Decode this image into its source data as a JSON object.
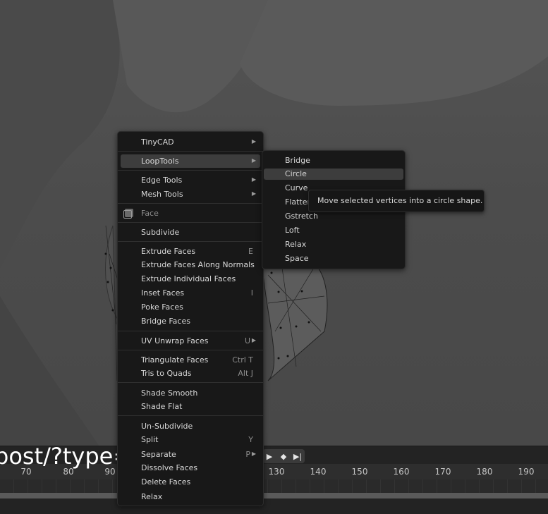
{
  "main_menu": {
    "items": [
      {
        "label": "TinyCAD",
        "submenu": true
      },
      {
        "label": "LoopTools",
        "submenu": true
      },
      {
        "label": "Edge Tools",
        "submenu": true
      },
      {
        "label": "Mesh Tools",
        "submenu": true
      },
      {
        "label": "Face",
        "header": true,
        "icon": "face-icon"
      },
      {
        "label": "Subdivide"
      },
      {
        "label": "Extrude Faces",
        "shortcut": "E"
      },
      {
        "label": "Extrude Faces Along Normals"
      },
      {
        "label": "Extrude Individual Faces"
      },
      {
        "label": "Inset Faces",
        "shortcut": "I"
      },
      {
        "label": "Poke Faces"
      },
      {
        "label": "Bridge Faces"
      },
      {
        "label": "UV Unwrap Faces",
        "shortcut": "U",
        "submenu": true
      },
      {
        "label": "Triangulate Faces",
        "shortcut": "Ctrl T"
      },
      {
        "label": "Tris to Quads",
        "shortcut": "Alt J"
      },
      {
        "label": "Shade Smooth"
      },
      {
        "label": "Shade Flat"
      },
      {
        "label": "Un-Subdivide"
      },
      {
        "label": "Split",
        "shortcut": "Y"
      },
      {
        "label": "Separate",
        "shortcut": "P",
        "submenu": true
      },
      {
        "label": "Dissolve Faces"
      },
      {
        "label": "Delete Faces"
      },
      {
        "label": "Relax"
      }
    ]
  },
  "loop_tools_menu": {
    "items": [
      "Bridge",
      "Circle",
      "Curve",
      "Flatten",
      "Gstretch",
      "Loft",
      "Relax",
      "Space"
    ],
    "active": "Circle"
  },
  "tooltip": {
    "text": "Move selected vertices into a circle shape."
  },
  "timeline": {
    "frame_labels": [
      "70",
      "80",
      "90",
      "130",
      "140",
      "150",
      "160",
      "170",
      "180",
      "190"
    ]
  },
  "overlay": {
    "url_text": "post/?type=post"
  },
  "colors": {
    "menu_bg": "#181818",
    "highlight": "#3d3d3d",
    "viewport_bg": "#4c4c4c"
  }
}
